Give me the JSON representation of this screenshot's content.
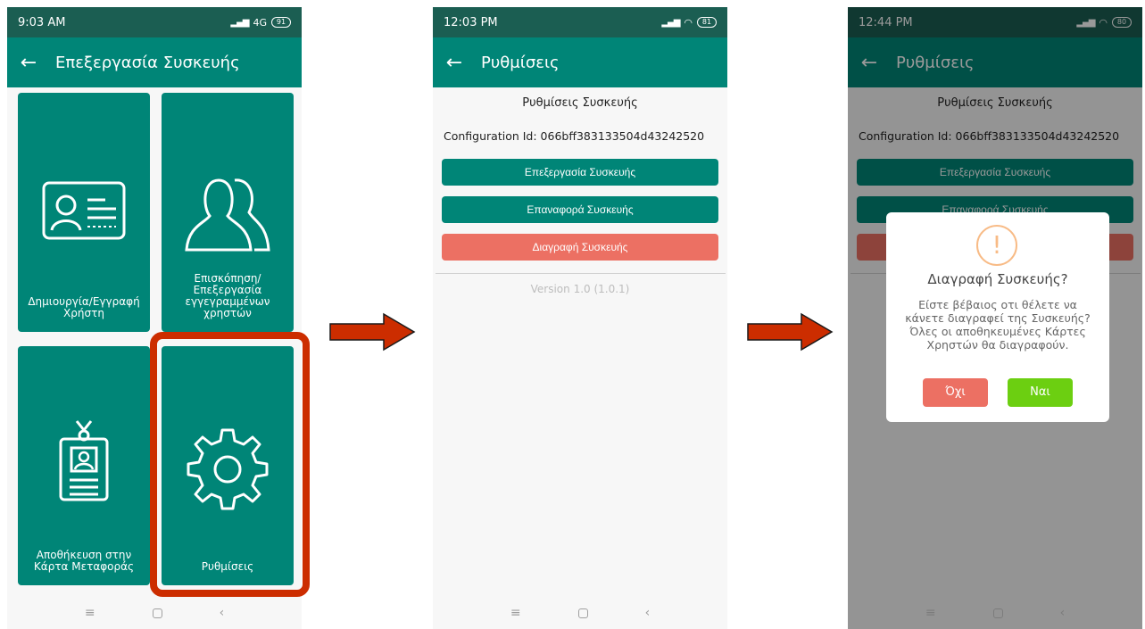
{
  "phone1": {
    "time": "9:03 AM",
    "network": "4G",
    "battery": "91",
    "title": "Επεξεργασία Συσκευής",
    "tiles": {
      "create": "Δημιουργία/Εγγραφή Χρήστη",
      "overview": "Επισκόπηση/ Επεξεργασία εγγεγραμμένων χρηστών",
      "transfer": "Αποθήκευση στην Κάρτα Μεταφοράς",
      "settings": "Ρυθμίσεις"
    }
  },
  "phone2": {
    "time": "12:03 PM",
    "battery": "81",
    "title": "Ρυθμίσεις",
    "heading": "Ρυθμίσεις Συσκευής",
    "config_id": "Configuration Id: 066bff383133504d43242520",
    "buttons": {
      "edit": "Επεξεργασία Συσκευής",
      "reset": "Επαναφορά Συσκευής",
      "delete": "Διαγραφή Συσκευής"
    },
    "version": "Version 1.0 (1.0.1)"
  },
  "phone3": {
    "time": "12:44 PM",
    "battery": "80",
    "title": "Ρυθμίσεις",
    "heading": "Ρυθμίσεις Συσκευής",
    "config_id": "Configuration Id: 066bff383133504d43242520",
    "buttons": {
      "edit": "Επεξεργασία Συσκευής",
      "reset": "Επαναφορά Συσκευής"
    },
    "dialog": {
      "title": "Διαγραφή Συσκευής?",
      "message": "Είστε βέβαιος οτι θέλετε να κάνετε διαγραφεί της Συσκευής? Όλες οι αποθηκευμένες Κάρτες Χρηστών θα διαγραφούν.",
      "no": "Όχι",
      "yes": "Ναι"
    }
  },
  "colors": {
    "primary": "#008577",
    "status_bar": "#1b5e52",
    "danger": "#ec7063",
    "confirm": "#6ccf11",
    "highlight": "#cc2d00"
  }
}
